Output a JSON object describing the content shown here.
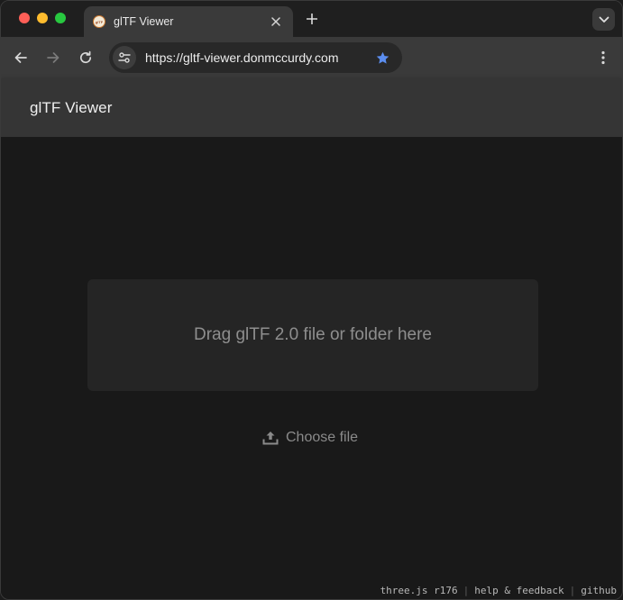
{
  "browser": {
    "tab": {
      "title": "glTF Viewer",
      "favicon_icon": "gltf-favicon-icon"
    },
    "address": {
      "url": "https://gltf-viewer.donmccurdy.com",
      "bookmarked": true
    },
    "accent": "#5b8def"
  },
  "app": {
    "title": "glTF Viewer",
    "dropzone": {
      "text": "Drag glTF 2.0 file or folder here"
    },
    "choose_file": {
      "label": "Choose file",
      "icon": "upload-icon"
    }
  },
  "footer": {
    "version": "three.js r176",
    "help": "help & feedback",
    "github": "github"
  }
}
